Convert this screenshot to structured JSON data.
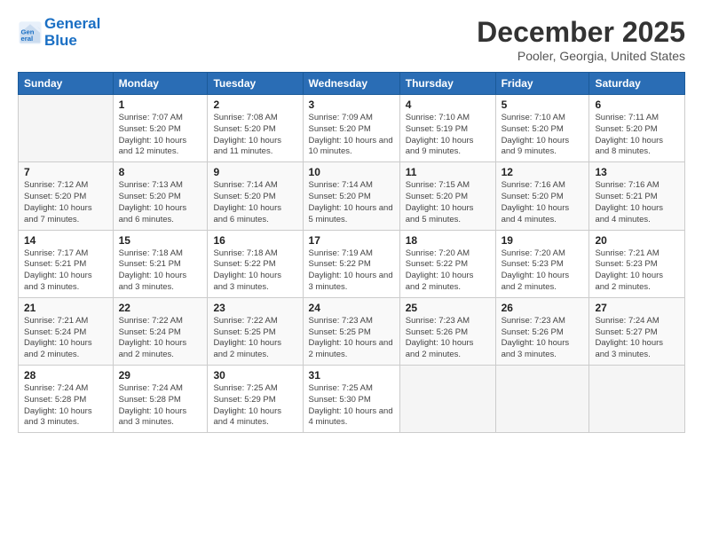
{
  "header": {
    "logo_line1": "General",
    "logo_line2": "Blue",
    "month_title": "December 2025",
    "location": "Pooler, Georgia, United States"
  },
  "columns": [
    "Sunday",
    "Monday",
    "Tuesday",
    "Wednesday",
    "Thursday",
    "Friday",
    "Saturday"
  ],
  "weeks": [
    [
      {
        "date": "",
        "sunrise": "",
        "sunset": "",
        "daylight": ""
      },
      {
        "date": "1",
        "sunrise": "Sunrise: 7:07 AM",
        "sunset": "Sunset: 5:20 PM",
        "daylight": "Daylight: 10 hours and 12 minutes."
      },
      {
        "date": "2",
        "sunrise": "Sunrise: 7:08 AM",
        "sunset": "Sunset: 5:20 PM",
        "daylight": "Daylight: 10 hours and 11 minutes."
      },
      {
        "date": "3",
        "sunrise": "Sunrise: 7:09 AM",
        "sunset": "Sunset: 5:20 PM",
        "daylight": "Daylight: 10 hours and 10 minutes."
      },
      {
        "date": "4",
        "sunrise": "Sunrise: 7:10 AM",
        "sunset": "Sunset: 5:19 PM",
        "daylight": "Daylight: 10 hours and 9 minutes."
      },
      {
        "date": "5",
        "sunrise": "Sunrise: 7:10 AM",
        "sunset": "Sunset: 5:20 PM",
        "daylight": "Daylight: 10 hours and 9 minutes."
      },
      {
        "date": "6",
        "sunrise": "Sunrise: 7:11 AM",
        "sunset": "Sunset: 5:20 PM",
        "daylight": "Daylight: 10 hours and 8 minutes."
      }
    ],
    [
      {
        "date": "7",
        "sunrise": "Sunrise: 7:12 AM",
        "sunset": "Sunset: 5:20 PM",
        "daylight": "Daylight: 10 hours and 7 minutes."
      },
      {
        "date": "8",
        "sunrise": "Sunrise: 7:13 AM",
        "sunset": "Sunset: 5:20 PM",
        "daylight": "Daylight: 10 hours and 6 minutes."
      },
      {
        "date": "9",
        "sunrise": "Sunrise: 7:14 AM",
        "sunset": "Sunset: 5:20 PM",
        "daylight": "Daylight: 10 hours and 6 minutes."
      },
      {
        "date": "10",
        "sunrise": "Sunrise: 7:14 AM",
        "sunset": "Sunset: 5:20 PM",
        "daylight": "Daylight: 10 hours and 5 minutes."
      },
      {
        "date": "11",
        "sunrise": "Sunrise: 7:15 AM",
        "sunset": "Sunset: 5:20 PM",
        "daylight": "Daylight: 10 hours and 5 minutes."
      },
      {
        "date": "12",
        "sunrise": "Sunrise: 7:16 AM",
        "sunset": "Sunset: 5:20 PM",
        "daylight": "Daylight: 10 hours and 4 minutes."
      },
      {
        "date": "13",
        "sunrise": "Sunrise: 7:16 AM",
        "sunset": "Sunset: 5:21 PM",
        "daylight": "Daylight: 10 hours and 4 minutes."
      }
    ],
    [
      {
        "date": "14",
        "sunrise": "Sunrise: 7:17 AM",
        "sunset": "Sunset: 5:21 PM",
        "daylight": "Daylight: 10 hours and 3 minutes."
      },
      {
        "date": "15",
        "sunrise": "Sunrise: 7:18 AM",
        "sunset": "Sunset: 5:21 PM",
        "daylight": "Daylight: 10 hours and 3 minutes."
      },
      {
        "date": "16",
        "sunrise": "Sunrise: 7:18 AM",
        "sunset": "Sunset: 5:22 PM",
        "daylight": "Daylight: 10 hours and 3 minutes."
      },
      {
        "date": "17",
        "sunrise": "Sunrise: 7:19 AM",
        "sunset": "Sunset: 5:22 PM",
        "daylight": "Daylight: 10 hours and 3 minutes."
      },
      {
        "date": "18",
        "sunrise": "Sunrise: 7:20 AM",
        "sunset": "Sunset: 5:22 PM",
        "daylight": "Daylight: 10 hours and 2 minutes."
      },
      {
        "date": "19",
        "sunrise": "Sunrise: 7:20 AM",
        "sunset": "Sunset: 5:23 PM",
        "daylight": "Daylight: 10 hours and 2 minutes."
      },
      {
        "date": "20",
        "sunrise": "Sunrise: 7:21 AM",
        "sunset": "Sunset: 5:23 PM",
        "daylight": "Daylight: 10 hours and 2 minutes."
      }
    ],
    [
      {
        "date": "21",
        "sunrise": "Sunrise: 7:21 AM",
        "sunset": "Sunset: 5:24 PM",
        "daylight": "Daylight: 10 hours and 2 minutes."
      },
      {
        "date": "22",
        "sunrise": "Sunrise: 7:22 AM",
        "sunset": "Sunset: 5:24 PM",
        "daylight": "Daylight: 10 hours and 2 minutes."
      },
      {
        "date": "23",
        "sunrise": "Sunrise: 7:22 AM",
        "sunset": "Sunset: 5:25 PM",
        "daylight": "Daylight: 10 hours and 2 minutes."
      },
      {
        "date": "24",
        "sunrise": "Sunrise: 7:23 AM",
        "sunset": "Sunset: 5:25 PM",
        "daylight": "Daylight: 10 hours and 2 minutes."
      },
      {
        "date": "25",
        "sunrise": "Sunrise: 7:23 AM",
        "sunset": "Sunset: 5:26 PM",
        "daylight": "Daylight: 10 hours and 2 minutes."
      },
      {
        "date": "26",
        "sunrise": "Sunrise: 7:23 AM",
        "sunset": "Sunset: 5:26 PM",
        "daylight": "Daylight: 10 hours and 3 minutes."
      },
      {
        "date": "27",
        "sunrise": "Sunrise: 7:24 AM",
        "sunset": "Sunset: 5:27 PM",
        "daylight": "Daylight: 10 hours and 3 minutes."
      }
    ],
    [
      {
        "date": "28",
        "sunrise": "Sunrise: 7:24 AM",
        "sunset": "Sunset: 5:28 PM",
        "daylight": "Daylight: 10 hours and 3 minutes."
      },
      {
        "date": "29",
        "sunrise": "Sunrise: 7:24 AM",
        "sunset": "Sunset: 5:28 PM",
        "daylight": "Daylight: 10 hours and 3 minutes."
      },
      {
        "date": "30",
        "sunrise": "Sunrise: 7:25 AM",
        "sunset": "Sunset: 5:29 PM",
        "daylight": "Daylight: 10 hours and 4 minutes."
      },
      {
        "date": "31",
        "sunrise": "Sunrise: 7:25 AM",
        "sunset": "Sunset: 5:30 PM",
        "daylight": "Daylight: 10 hours and 4 minutes."
      },
      {
        "date": "",
        "sunrise": "",
        "sunset": "",
        "daylight": ""
      },
      {
        "date": "",
        "sunrise": "",
        "sunset": "",
        "daylight": ""
      },
      {
        "date": "",
        "sunrise": "",
        "sunset": "",
        "daylight": ""
      }
    ]
  ]
}
